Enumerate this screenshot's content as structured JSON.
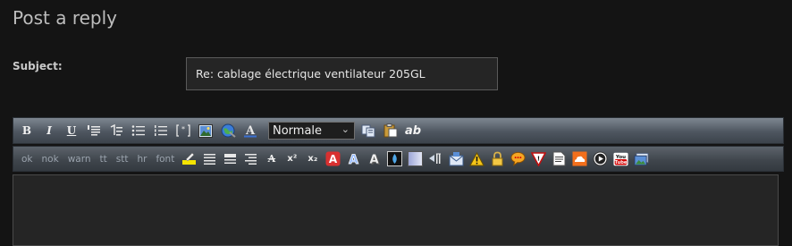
{
  "page": {
    "title": "Post a reply"
  },
  "subject": {
    "label": "Subject:",
    "value": "Re: cablage électrique ventilateur 205GL"
  },
  "toolbar1": {
    "bold": "B",
    "italic": "I",
    "underline": "U",
    "font_color_letter": "A",
    "size_select": "Normale",
    "ab_label": "ab"
  },
  "toolbar2": {
    "text_buttons": [
      "ok",
      "nok",
      "warn",
      "tt",
      "stt",
      "hr",
      "font"
    ],
    "superscript": "x²",
    "subscript": "x₂",
    "letter_a": "A"
  },
  "icons": {
    "toolbar1": [
      "quote-icon",
      "code-icon",
      "bullet-list-icon",
      "numbered-list-icon",
      "list-item-icon",
      "image-icon",
      "url-icon",
      "font-color-icon",
      "copy-icon",
      "paste-icon",
      "spellcheck-icon"
    ],
    "toolbar2": [
      "highlight-icon",
      "align-left-icon",
      "align-center-icon",
      "align-right-icon",
      "strikethrough-icon",
      "superscript-icon",
      "subscript-icon",
      "red-text-icon",
      "glow-text-icon",
      "shadow-text-icon",
      "drop-icon",
      "gradient-icon",
      "direction-icon",
      "spoiler-icon",
      "warning-icon",
      "lock-icon",
      "speech-bubble-icon",
      "flag-icon",
      "document-icon",
      "soundcloud-icon",
      "play-icon",
      "youtube-icon",
      "gallery-icon"
    ]
  },
  "colors": {
    "background": "#141414",
    "toolbar": "#5a626c",
    "editor": "#252525"
  }
}
